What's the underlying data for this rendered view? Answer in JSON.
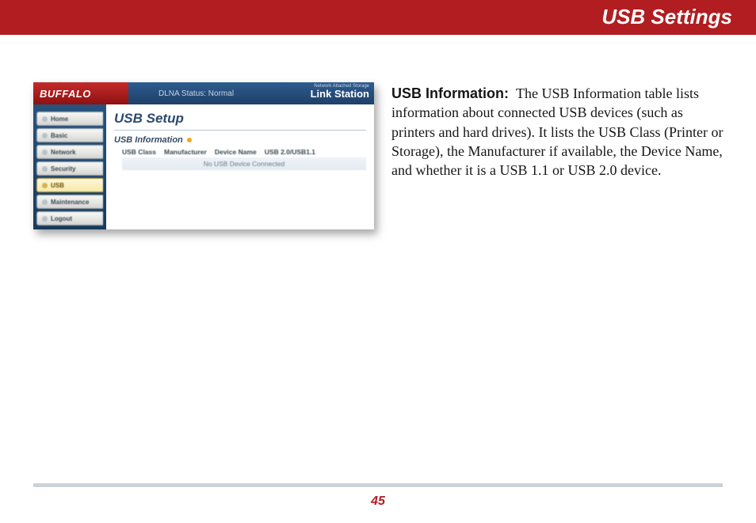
{
  "header": {
    "title": "USB Settings"
  },
  "screenshot": {
    "brand": "BUFFALO",
    "dlna_status": "DLNA Status: Normal",
    "logo_subtitle": "Network Attached Storage",
    "logo_title": "Link Station",
    "nav": {
      "home": "Home",
      "basic": "Basic",
      "network": "Network",
      "security": "Security",
      "usb": "USB",
      "maintenance": "Maintenance",
      "logout": "Logout"
    },
    "main": {
      "heading": "USB Setup",
      "section": "USB Information",
      "columns": {
        "class": "USB Class",
        "manuf": "Manufacturer",
        "devname": "Device Name",
        "speed": "USB 2.0/USB1.1"
      },
      "empty_msg": "No USB Device Connected"
    }
  },
  "description": {
    "label": "USB Information:",
    "body": "The USB Information table lists information about connected USB devices (such as printers and hard drives).  It lists the USB Class (Printer or Storage), the Manufacturer if available, the Device Name, and whether it is a USB 1.1 or USB 2.0 device."
  },
  "page_number": "45"
}
